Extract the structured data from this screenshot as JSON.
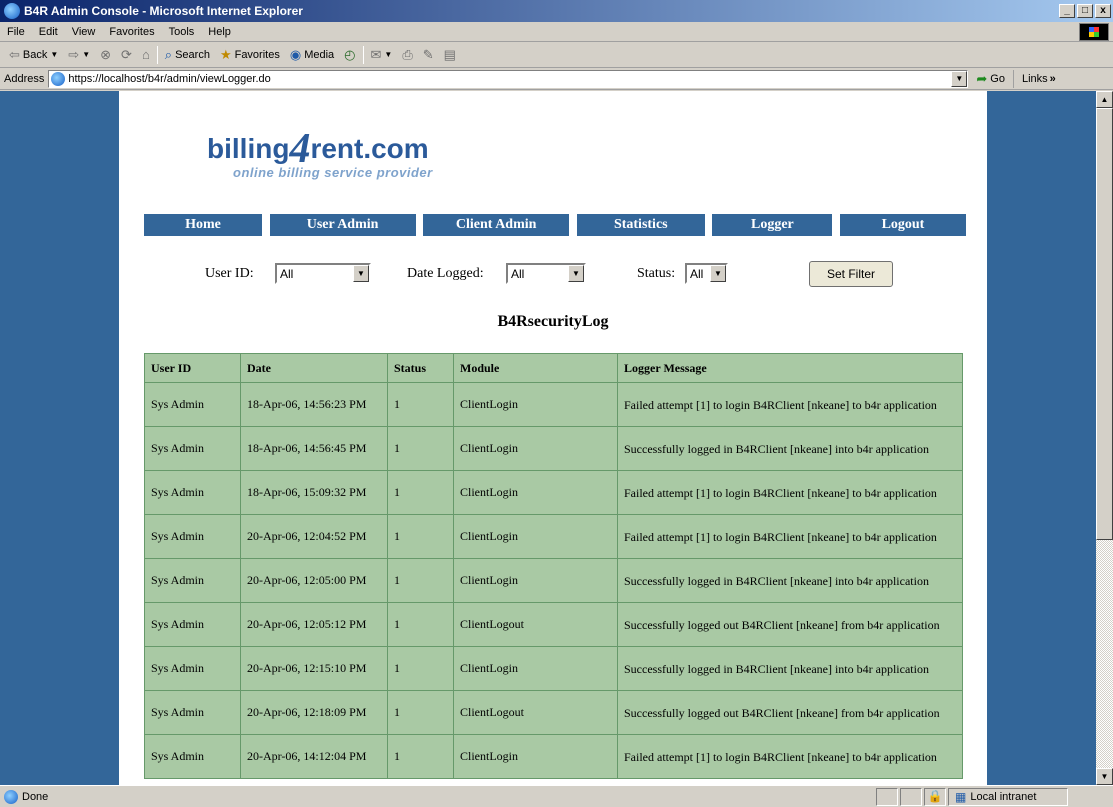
{
  "window": {
    "title": "B4R Admin Console - Microsoft Internet Explorer",
    "controls": [
      "_",
      "□",
      "x"
    ]
  },
  "menu": [
    "File",
    "Edit",
    "View",
    "Favorites",
    "Tools",
    "Help"
  ],
  "toolbar": {
    "back": "Back",
    "search": "Search",
    "favorites": "Favorites",
    "media": "Media"
  },
  "address": {
    "label": "Address",
    "url": "https://localhost/b4r/admin/viewLogger.do",
    "go": "Go",
    "links": "Links"
  },
  "logo": {
    "brand_left": "billing",
    "brand_num": "4",
    "brand_right": "rent.com",
    "tagline": "online billing service provider"
  },
  "nav": [
    "Home",
    "User Admin",
    "Client Admin",
    "Statistics",
    "Logger",
    "Logout"
  ],
  "filters": {
    "user_label": "User ID:",
    "user_value": "All",
    "date_label": "Date Logged:",
    "date_value": "All",
    "status_label": "Status:",
    "status_value": "All",
    "button": "Set Filter"
  },
  "log_title": "B4RsecurityLog",
  "table": {
    "headers": [
      "User ID",
      "Date",
      "Status",
      "Module",
      "Logger Message"
    ],
    "rows": [
      [
        "Sys Admin",
        "18-Apr-06, 14:56:23 PM",
        "1",
        "ClientLogin",
        "Failed attempt [1] to login B4RClient [nkeane] to b4r application"
      ],
      [
        "Sys Admin",
        "18-Apr-06, 14:56:45 PM",
        "1",
        "ClientLogin",
        "Successfully logged in B4RClient [nkeane] into b4r application"
      ],
      [
        "Sys Admin",
        "18-Apr-06, 15:09:32 PM",
        "1",
        "ClientLogin",
        "Failed attempt [1] to login B4RClient [nkeane] to b4r application"
      ],
      [
        "Sys Admin",
        "20-Apr-06, 12:04:52 PM",
        "1",
        "ClientLogin",
        "Failed attempt [1] to login B4RClient [nkeane] to b4r application"
      ],
      [
        "Sys Admin",
        "20-Apr-06, 12:05:00 PM",
        "1",
        "ClientLogin",
        "Successfully logged in B4RClient [nkeane] into b4r application"
      ],
      [
        "Sys Admin",
        "20-Apr-06, 12:05:12 PM",
        "1",
        "ClientLogout",
        "Successfully logged out B4RClient [nkeane] from b4r application"
      ],
      [
        "Sys Admin",
        "20-Apr-06, 12:15:10 PM",
        "1",
        "ClientLogin",
        "Successfully logged in B4RClient [nkeane] into b4r application"
      ],
      [
        "Sys Admin",
        "20-Apr-06, 12:18:09 PM",
        "1",
        "ClientLogout",
        "Successfully logged out B4RClient [nkeane] from b4r application"
      ],
      [
        "Sys Admin",
        "20-Apr-06, 14:12:04 PM",
        "1",
        "ClientLogin",
        "Failed attempt [1] to login B4RClient [nkeane] to b4r application"
      ]
    ]
  },
  "status": {
    "text": "Done",
    "zone": "Local intranet"
  },
  "colors": {
    "page_bg": "#336699",
    "nav_bg": "#336699",
    "table_bg": "#a9c9a4",
    "table_border": "#66996a"
  }
}
